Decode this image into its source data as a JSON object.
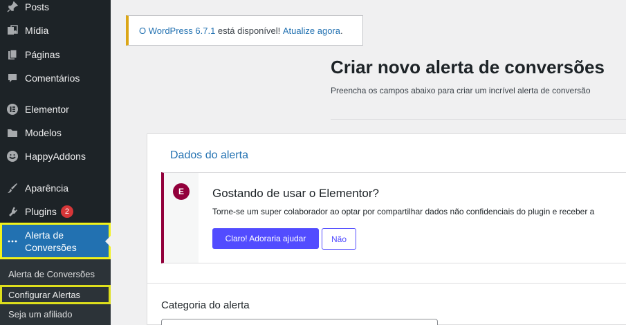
{
  "sidebar": {
    "items": [
      {
        "label": "Posts",
        "icon": "pin-icon"
      },
      {
        "label": "Mídia",
        "icon": "media-icon"
      },
      {
        "label": "Páginas",
        "icon": "pages-icon"
      },
      {
        "label": "Comentários",
        "icon": "comment-icon"
      },
      {
        "label": "Elementor",
        "icon": "elementor-icon"
      },
      {
        "label": "Modelos",
        "icon": "folder-icon"
      },
      {
        "label": "HappyAddons",
        "icon": "happy-icon"
      },
      {
        "label": "Aparência",
        "icon": "brush-icon"
      },
      {
        "label": "Plugins",
        "icon": "plugin-icon",
        "badge": "2"
      }
    ],
    "active": {
      "label_line1": "Alerta de",
      "label_line2": "Conversões",
      "icon": "dots-icon"
    },
    "submenu": [
      {
        "label": "Alerta de Conversões"
      },
      {
        "label": "Configurar Alertas"
      },
      {
        "label": "Seja um afiliado"
      }
    ]
  },
  "notice": {
    "link1": "O WordPress 6.7.1",
    "text": " está disponível! ",
    "link2": "Atualize agora",
    "end": "."
  },
  "page": {
    "title": "Criar novo alerta de conversões",
    "subtitle": "Preencha os campos abaixo para criar um incrível alerta de conversão"
  },
  "card": {
    "tab": "Dados do alerta",
    "promo": {
      "logo": "E",
      "title": "Gostando de usar o Elementor?",
      "text": "Torne-se um super colaborador ao optar por compartilhar dados não confidenciais do plugin e receber a",
      "primary": "Claro! Adoraria ajudar",
      "secondary": "Não"
    },
    "field_label": "Categoria do alerta"
  },
  "colors": {
    "sidebar_bg": "#1d2327",
    "active_bg": "#2271b1",
    "highlight": "#f2f21a",
    "elementor": "#92003b",
    "button": "#524cff"
  }
}
